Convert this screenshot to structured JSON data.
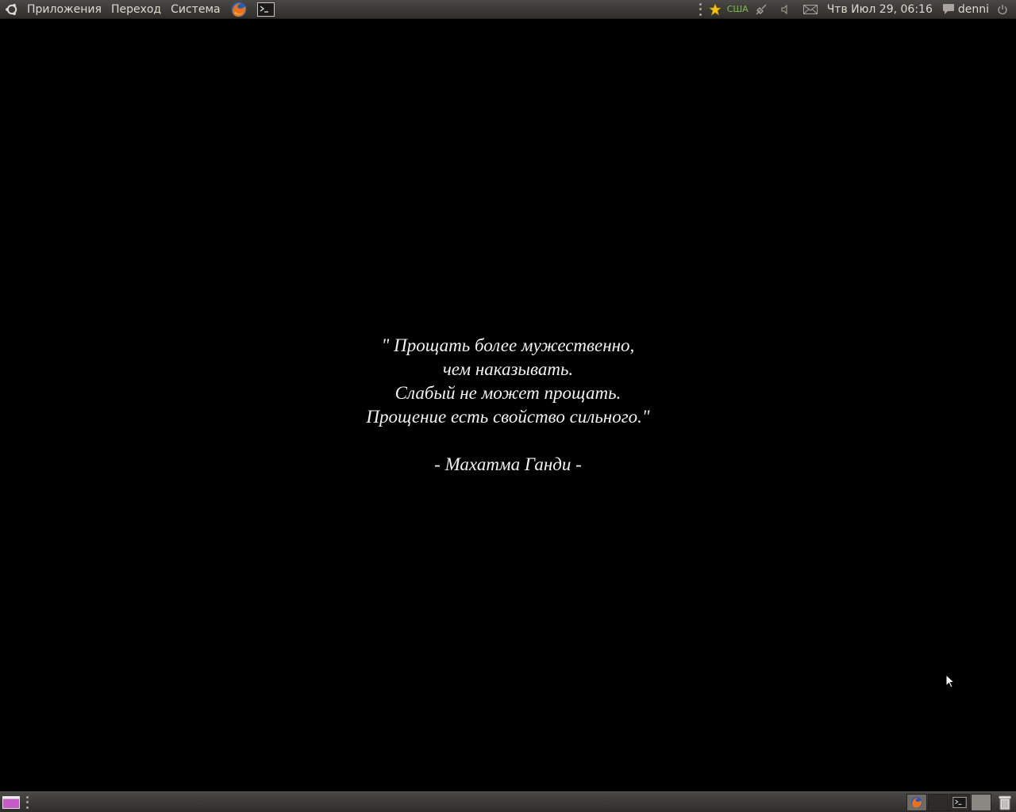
{
  "top_panel": {
    "menus": {
      "applications": "Приложения",
      "places": "Переход",
      "system": "Система"
    },
    "launchers": [
      "firefox-icon",
      "terminal-icon"
    ],
    "tray": {
      "keyboard_layout": "США",
      "clock": "Чтв Июл 29, 06:16",
      "user": "denni"
    }
  },
  "desktop": {
    "quote_lines": [
      "\" Прощать более мужественно,",
      "чем наказывать.",
      "Слабый не может прощать.",
      "Прощение есть свойство сильного.\""
    ],
    "author": "- Махатма Ганди -"
  },
  "bottom_panel": {
    "workspaces": [
      "firefox-icon",
      "empty",
      "terminal-icon",
      "empty"
    ],
    "trash": "trash-icon"
  }
}
